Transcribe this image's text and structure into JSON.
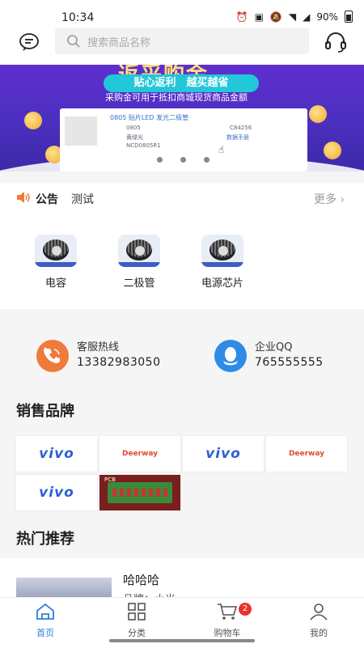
{
  "status_bar": {
    "time": "10:34",
    "battery": "90%"
  },
  "header": {
    "search_placeholder": "搜索商品名称"
  },
  "banner": {
    "title": "返采购金",
    "slogan": "贴心返利　越买越省",
    "subtitle": "采购金可用于抵扣商城现货商品金额",
    "card_lines": [
      "0805 贴片LED  发光二极管",
      "0805",
      "黄绿光",
      "NCD0805R1",
      "C84256",
      "数据手册"
    ],
    "slides": 3
  },
  "notice": {
    "label": "公告",
    "text": "测试",
    "more": "更多"
  },
  "categories": [
    {
      "name": "电容"
    },
    {
      "name": "二极管"
    },
    {
      "name": "电源芯片"
    }
  ],
  "contacts": [
    {
      "title": "客服热线",
      "value": "13382983050",
      "color": "#f07a3a"
    },
    {
      "title": "企业QQ",
      "value": "765555555",
      "color": "#2f8be6"
    }
  ],
  "brands": {
    "title": "销售品牌",
    "items": [
      {
        "name": "vivo"
      },
      {
        "name": "Deerway"
      },
      {
        "name": "vivo"
      },
      {
        "name": "Deerway"
      },
      {
        "name": "vivo"
      },
      {
        "name": "PCB"
      }
    ]
  },
  "recommend": {
    "title": "热门推荐",
    "item": {
      "name": "哈哈哈",
      "brand": "品牌：小米"
    }
  },
  "tabbar": {
    "items": [
      {
        "label": "首页",
        "active": true
      },
      {
        "label": "分类",
        "active": false
      },
      {
        "label": "购物车",
        "active": false,
        "badge": "2"
      },
      {
        "label": "我的",
        "active": false
      }
    ]
  },
  "colors": {
    "accent": "#2a83d8",
    "badge": "#e8332c",
    "banner": "#4b2fbf",
    "notice_icon": "#f07a3a"
  }
}
